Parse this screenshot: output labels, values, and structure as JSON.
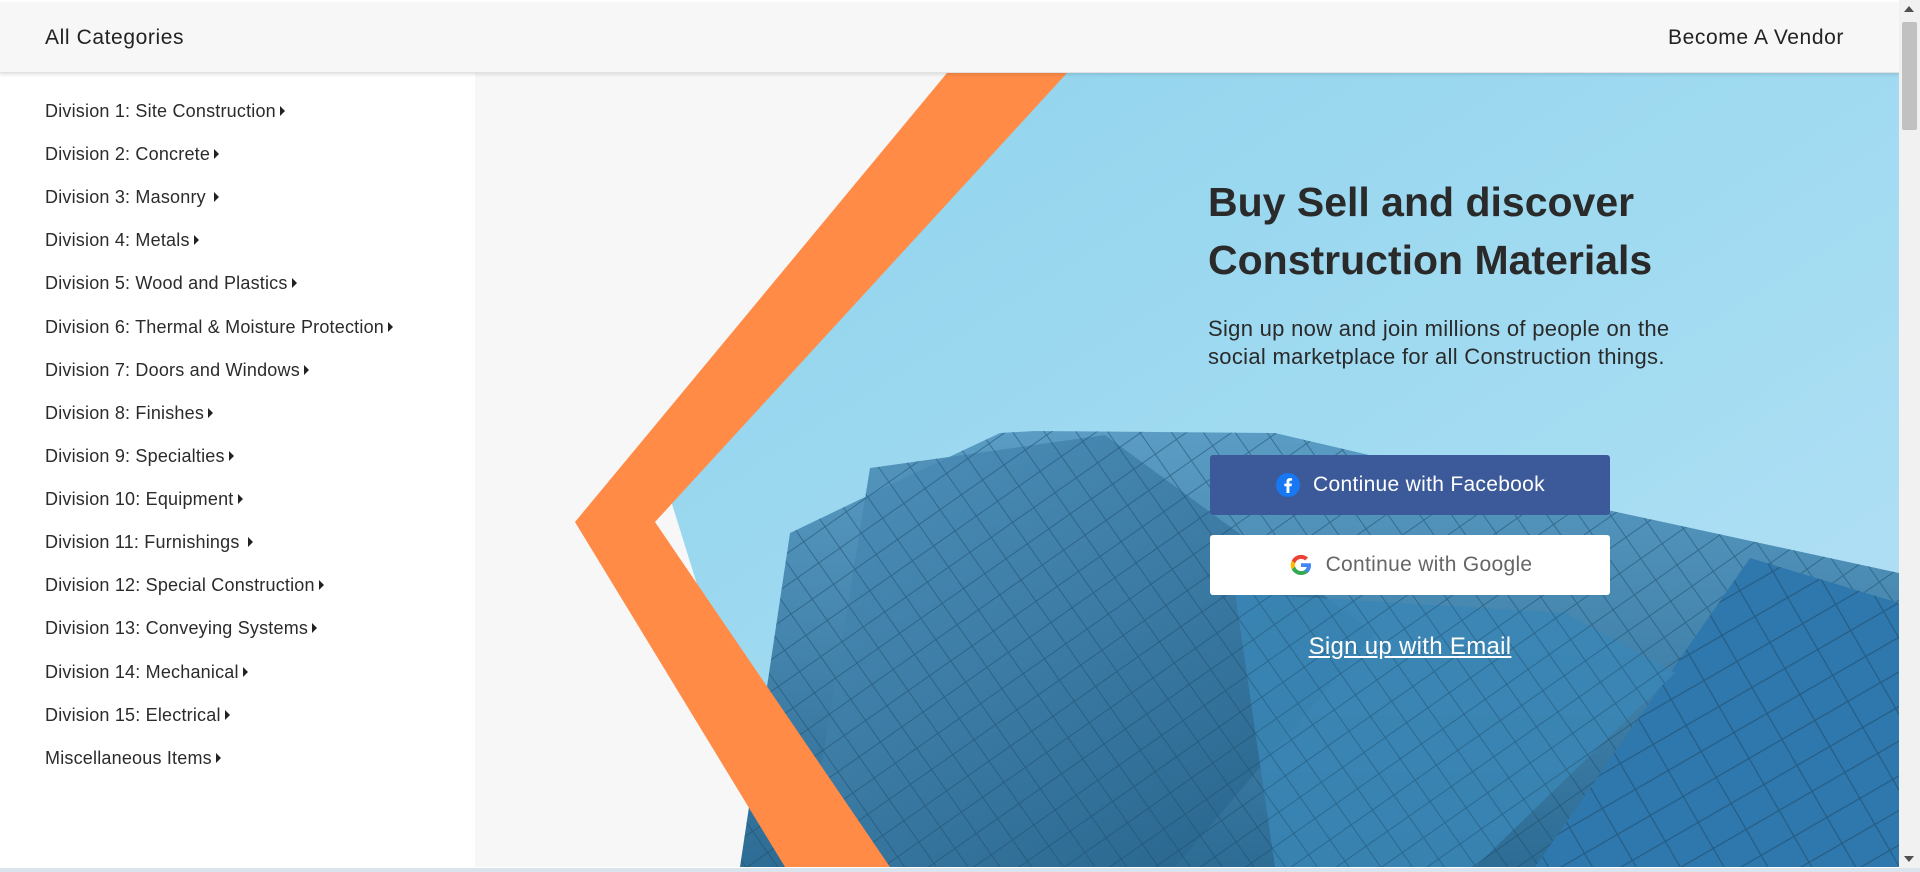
{
  "header": {
    "all_categories": "All Categories",
    "become_vendor": "Become A Vendor"
  },
  "sidebar": {
    "items": [
      {
        "label": "Division 1: Site Construction"
      },
      {
        "label": "Division 2: Concrete"
      },
      {
        "label": "Division 3: Masonry"
      },
      {
        "label": "Division 4: Metals"
      },
      {
        "label": "Division 5: Wood and Plastics"
      },
      {
        "label": "Division 6: Thermal & Moisture Protection"
      },
      {
        "label": "Division 7: Doors and Windows"
      },
      {
        "label": "Division 8: Finishes"
      },
      {
        "label": "Division 9: Specialties"
      },
      {
        "label": "Division 10: Equipment"
      },
      {
        "label": "Division 11: Furnishings"
      },
      {
        "label": "Division 12: Special Construction"
      },
      {
        "label": "Division 13: Conveying Systems"
      },
      {
        "label": "Division 14: Mechanical"
      },
      {
        "label": "Division 15: Electrical"
      },
      {
        "label": "Miscellaneous Items"
      }
    ]
  },
  "hero": {
    "headline_line1": "Buy Sell and discover",
    "headline_line2": "Construction Materials",
    "subtext": "Sign up now and join millions of people on the social marketplace for all Construction things.",
    "facebook_button": "Continue with Facebook",
    "google_button": "Continue with Google",
    "email_link": "Sign up with Email"
  },
  "colors": {
    "accent_orange": "#ff8b47",
    "facebook_blue": "#3c5a99",
    "sky_blue": "#9fd8ef"
  }
}
